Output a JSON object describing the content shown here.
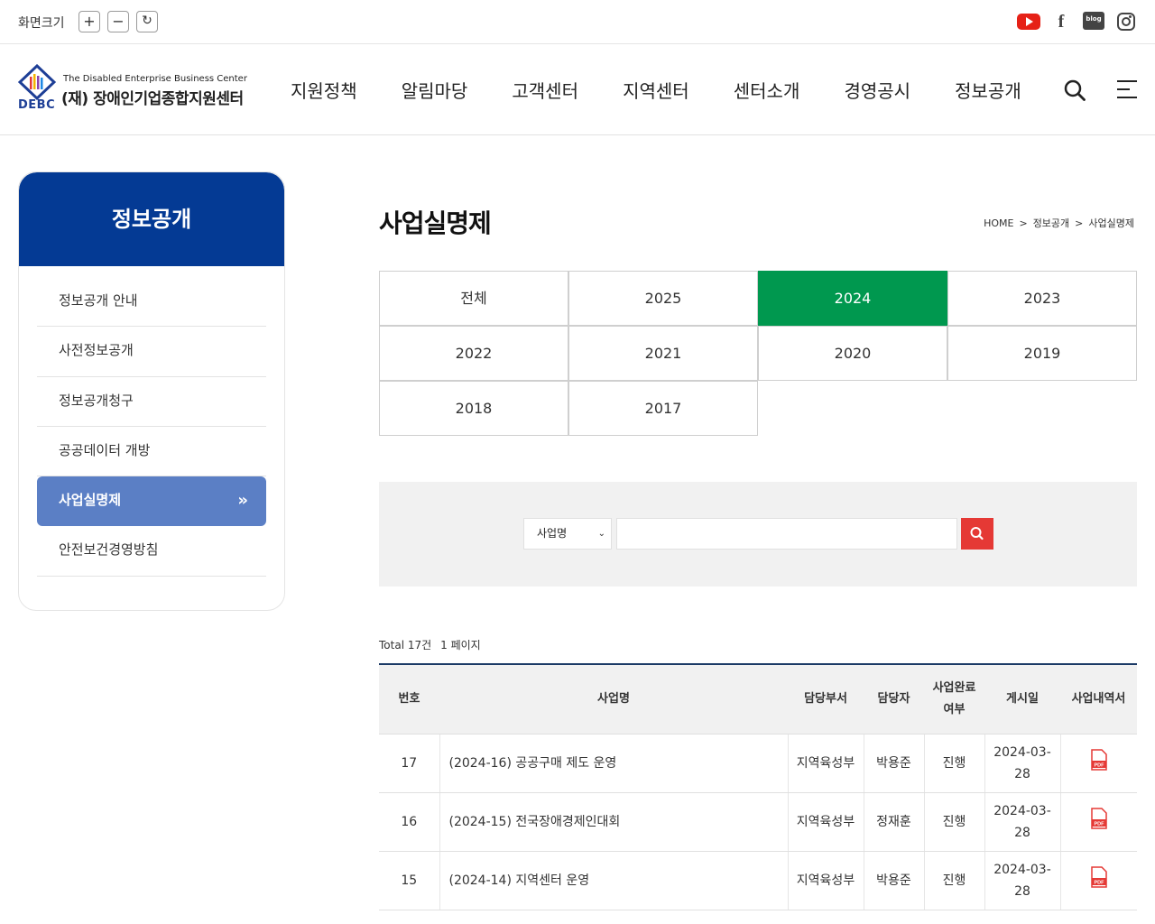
{
  "utility": {
    "zoom_label": "화면크기",
    "zoom_in": "+",
    "zoom_out": "−",
    "zoom_reset": "↻",
    "blog_label": "blog",
    "facebook_label": "f"
  },
  "logo": {
    "en": "The Disabled Enterprise Business Center",
    "ko": "(재) 장애인기업종합지원센터",
    "abbr": "DEBC"
  },
  "gnb": [
    "지원정책",
    "알림마당",
    "고객센터",
    "지역센터",
    "센터소개",
    "경영공시",
    "정보공개"
  ],
  "sidebar": {
    "title": "정보공개",
    "items": [
      "정보공개 안내",
      "사전정보공개",
      "정보공개청구",
      "공공데이터 개방",
      "사업실명제",
      "안전보건경영방침"
    ],
    "active_index": 4,
    "active_arrow": "»"
  },
  "page": {
    "title": "사업실명제",
    "breadcrumb": [
      "HOME",
      "정보공개",
      "사업실명제"
    ],
    "breadcrumb_sep": ">"
  },
  "years": {
    "items": [
      "전체",
      "2025",
      "2024",
      "2023",
      "2022",
      "2021",
      "2020",
      "2019",
      "2018",
      "2017"
    ],
    "active": "2024"
  },
  "search": {
    "select_value": "사업명",
    "chevron": "⌄",
    "input_value": ""
  },
  "list": {
    "total": "Total 17건",
    "page": "1 페이지",
    "headers": [
      "번호",
      "사업명",
      "담당부서",
      "담당자",
      "사업완료\n여부",
      "게시일",
      "사업내역서"
    ],
    "rows": [
      {
        "no": "17",
        "name": "(2024-16) 공공구매 제도 운영",
        "dept": "지역육성부",
        "manager": "박용준",
        "status": "진행",
        "date": "2024-03-28"
      },
      {
        "no": "16",
        "name": "(2024-15) 전국장애경제인대회",
        "dept": "지역육성부",
        "manager": "정재훈",
        "status": "진행",
        "date": "2024-03-28"
      },
      {
        "no": "15",
        "name": "(2024-14) 지역센터 운영",
        "dept": "지역육성부",
        "manager": "박용준",
        "status": "진행",
        "date": "2024-03-28"
      }
    ],
    "pdf_label": "PDF"
  },
  "colors": {
    "primary_navy": "#043a94",
    "active_year_green": "#00984f",
    "sidebar_active": "#5b7fc5",
    "search_button": "#e53935",
    "pdf_red": "#e53935"
  }
}
